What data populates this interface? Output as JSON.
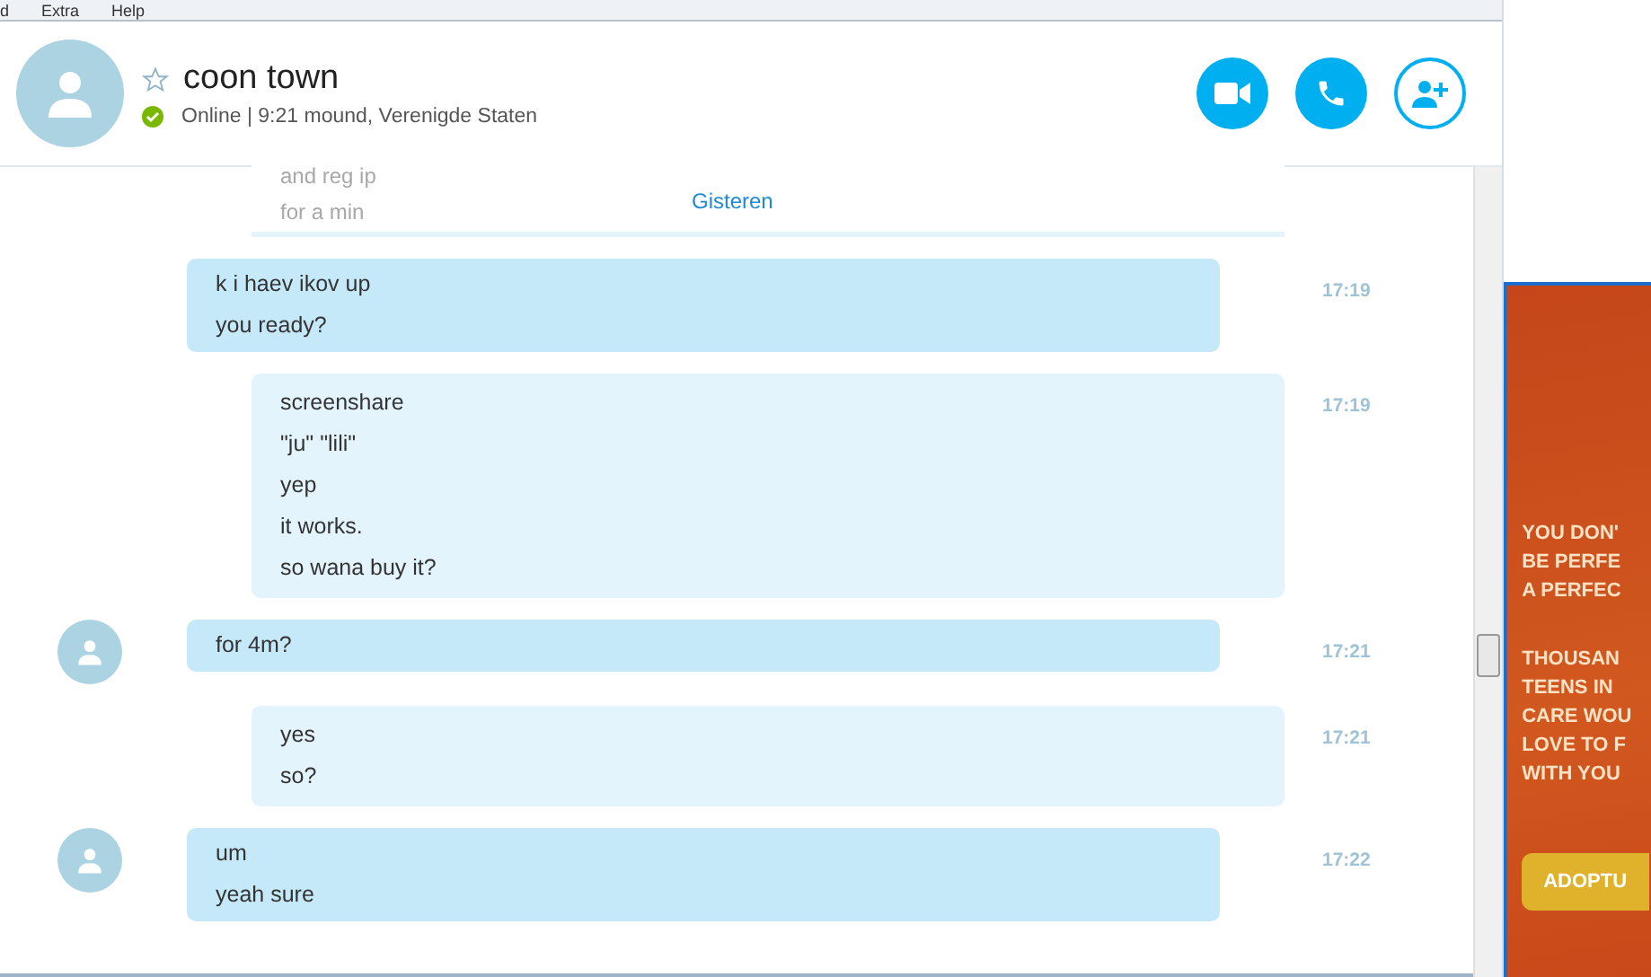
{
  "menu": [
    "d",
    "Extra",
    "Help"
  ],
  "contact": {
    "name": "coon town",
    "favorite": false,
    "status": "Online",
    "online": true,
    "separator": "|",
    "details": "9:21 mound, Verenigde Staten"
  },
  "actions": [
    {
      "kind": "video"
    },
    {
      "kind": "call"
    },
    {
      "kind": "add-contact"
    }
  ],
  "earlier": {
    "lines": [
      "and reg ip",
      "for a min"
    ]
  },
  "day_divider": "Gisteren",
  "messages": [
    {
      "kind": "incoming",
      "avatar": false,
      "lines": [
        "k i haev ikov up",
        "you ready?"
      ],
      "time": "17:19"
    },
    {
      "kind": "outgoing",
      "avatar": false,
      "lines": [
        "screenshare",
        "\"ju\" \"lili\"",
        "yep",
        "it works.",
        "so wana buy it?"
      ],
      "time": "17:19"
    },
    {
      "kind": "incoming",
      "avatar": true,
      "lines": [
        "for 4m?"
      ],
      "time": "17:21"
    },
    {
      "kind": "outgoing",
      "avatar": false,
      "lines": [
        "yes",
        "so?"
      ],
      "time": "17:21"
    },
    {
      "kind": "incoming",
      "avatar": true,
      "lines": [
        "um",
        "yeah sure"
      ],
      "time": "17:22"
    }
  ],
  "ad": {
    "headline": [
      "YOU DON'",
      "BE PERFE",
      "A PERFEC"
    ],
    "body": [
      "THOUSAN",
      "TEENS IN",
      "CARE WOU",
      "LOVE TO F",
      "WITH YOU"
    ],
    "button": "ADOPTU"
  }
}
